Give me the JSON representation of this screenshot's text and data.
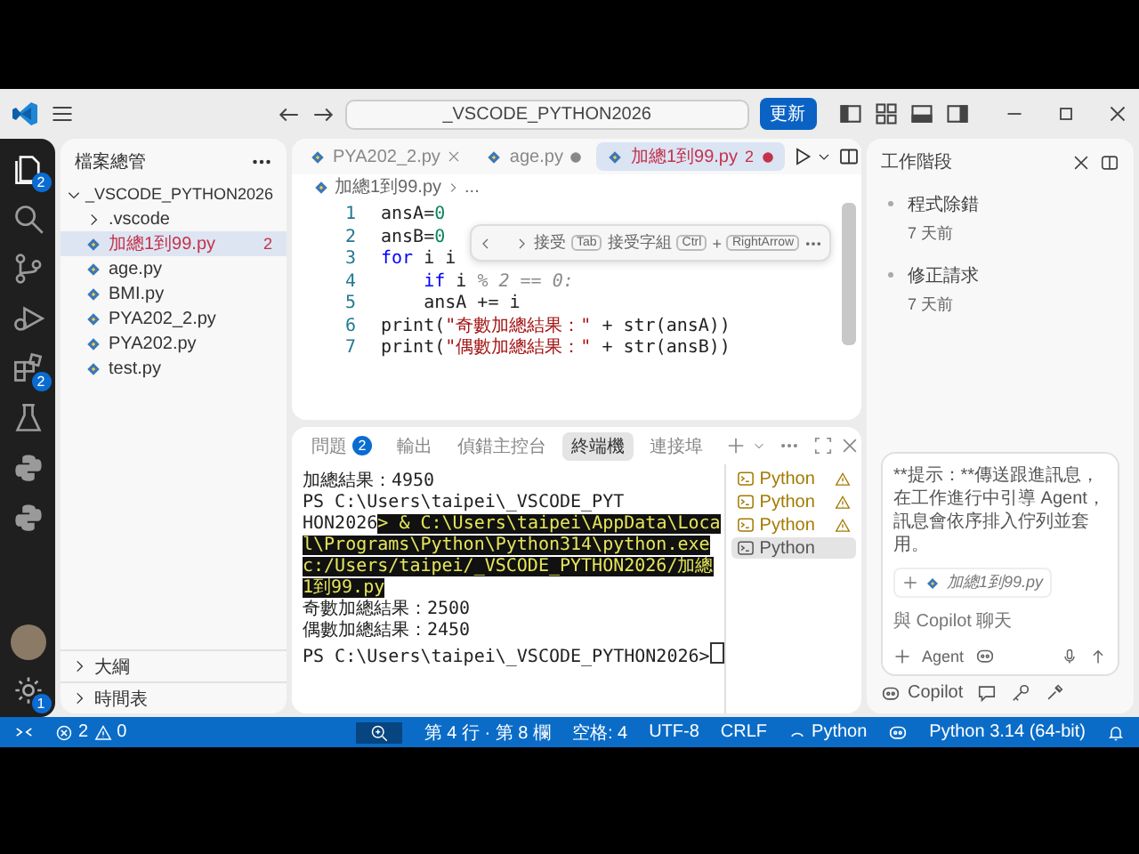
{
  "titlebar": {
    "search": "_VSCODE_PYTHON2026",
    "update_button": "更新"
  },
  "activity_bar": {
    "items": [
      {
        "kind": "explorer",
        "selected": true,
        "badge": "2"
      },
      {
        "kind": "search",
        "selected": false
      },
      {
        "kind": "source-control",
        "selected": false
      },
      {
        "kind": "run-debug",
        "selected": false
      },
      {
        "kind": "extensions",
        "selected": false,
        "badge": "2"
      },
      {
        "kind": "testing",
        "selected": false
      },
      {
        "kind": "python",
        "selected": false
      },
      {
        "kind": "python",
        "selected": false
      }
    ],
    "settings_badge": "1"
  },
  "explorer": {
    "title": "檔案總管",
    "folder": {
      "name": "_VSCODE_PYTHON2026",
      "expanded": true,
      "children": [
        {
          "kind": "folder",
          "name": ".vscode",
          "expanded": false,
          "selected": false
        },
        {
          "kind": "file",
          "name": "加總1到99.py",
          "selected": true,
          "problems": "2"
        },
        {
          "kind": "file",
          "name": "age.py",
          "selected": false
        },
        {
          "kind": "file",
          "name": "BMI.py",
          "selected": false
        },
        {
          "kind": "file",
          "name": "PYA202_2.py",
          "selected": false
        },
        {
          "kind": "file",
          "name": "PYA202.py",
          "selected": false
        },
        {
          "kind": "file",
          "name": "test.py",
          "selected": false
        }
      ]
    },
    "sections": [
      {
        "name": "大綱",
        "expanded": false
      },
      {
        "name": "時間表",
        "expanded": false
      }
    ]
  },
  "editor": {
    "tabs": [
      {
        "label": "PYA202_2.py",
        "selected": false,
        "modified": false
      },
      {
        "label": "age.py",
        "selected": false,
        "modified": true
      },
      {
        "label": "加總1到99.py",
        "selected": true,
        "modified": true,
        "problems": "2"
      }
    ],
    "breadcrumb": [
      "加總1到99.py",
      "..."
    ],
    "lines": [
      {
        "number": "1",
        "tokens": [
          {
            "kind": "plain",
            "text": "ansA="
          },
          {
            "kind": "number",
            "text": "0"
          }
        ]
      },
      {
        "number": "2",
        "tokens": [
          {
            "kind": "plain",
            "text": "ansB="
          },
          {
            "kind": "number",
            "text": "0"
          }
        ]
      },
      {
        "number": "3",
        "tokens": [
          {
            "kind": "keyword",
            "text": "for"
          },
          {
            "kind": "plain",
            "text": " i i"
          }
        ]
      },
      {
        "number": "4",
        "tokens": [
          {
            "kind": "keyword",
            "text": "    if"
          },
          {
            "kind": "plain",
            "text": " i"
          },
          {
            "kind": "ghost",
            "text": " % 2 == 0:"
          }
        ]
      },
      {
        "number": "5",
        "tokens": [
          {
            "kind": "plain",
            "text": "    ansA += i"
          }
        ]
      },
      {
        "number": "6",
        "tokens": [
          {
            "kind": "plain",
            "text": "print("
          },
          {
            "kind": "string",
            "text": "\"奇數加總結果：\""
          },
          {
            "kind": "plain",
            "text": " + str(ansA))"
          }
        ]
      },
      {
        "number": "7",
        "tokens": [
          {
            "kind": "plain",
            "text": "print("
          },
          {
            "kind": "string",
            "text": "\"偶數加總結果：\""
          },
          {
            "kind": "plain",
            "text": " + str(ansB))"
          }
        ]
      }
    ],
    "suggestion": {
      "accept": "接受",
      "accept_key": "Tab",
      "accept_word": "接受字組",
      "keys": [
        "Ctrl",
        "+",
        "RightArrow"
      ]
    }
  },
  "panel": {
    "tabs": [
      {
        "label": "問題",
        "selected": false,
        "badge": "2"
      },
      {
        "label": "輸出",
        "selected": false
      },
      {
        "label": "偵錯主控台",
        "selected": false
      },
      {
        "label": "終端機",
        "selected": true
      },
      {
        "label": "連接埠",
        "selected": false
      }
    ],
    "terminal": [
      [
        {
          "text": "加總結果：4950",
          "highlighted": false
        }
      ],
      [
        {
          "text": "PS C:\\Users\\taipei\\_VSCODE_PYT",
          "highlighted": false
        }
      ],
      [
        {
          "text": "HON2026",
          "highlighted": false
        },
        {
          "text": "> & C:\\Users\\taipei\\AppData\\Loca",
          "highlighted": true
        }
      ],
      [
        {
          "text": "l\\Programs\\Python\\Python314\\python.exe",
          "highlighted": true
        }
      ],
      [
        {
          "text": "c:/Users/taipei/_VSCODE_PYTHON2026/加總",
          "highlighted": true
        }
      ],
      [
        {
          "text": "1到99.py",
          "highlighted": true
        }
      ],
      [
        {
          "text": "奇數加總結果：2500",
          "highlighted": false
        }
      ],
      [
        {
          "text": "偶數加總結果：2450",
          "highlighted": false
        }
      ],
      [
        {
          "text": "PS C:\\Users\\taipei\\_VSCODE_PYTHON2026>",
          "highlighted": false
        }
      ]
    ],
    "terminals": [
      {
        "label": "Python",
        "warning": true,
        "selected": false
      },
      {
        "label": "Python",
        "warning": true,
        "selected": false
      },
      {
        "label": "Python",
        "warning": true,
        "selected": false
      },
      {
        "label": "Python",
        "warning": false,
        "selected": true
      }
    ]
  },
  "sessions": {
    "title": "工作階段",
    "items": [
      {
        "title": "程式除錯",
        "time": "7 天前"
      },
      {
        "title": "修正請求",
        "time": "7 天前"
      }
    ],
    "chat": {
      "hint": "**提示：**傳送跟進訊息，在工作進行中引導 Agent，訊息會依序排入佇列並套用。",
      "attachment": "加總1到99.py",
      "placeholder": "與 Copilot 聊天",
      "mode": "Agent"
    },
    "footer": "Copilot"
  },
  "status_bar": {
    "errors": "2",
    "warnings": "0",
    "position": "第 4 行 · 第 8 欄",
    "spaces": "空格: 4",
    "encoding": "UTF-8",
    "eol": "CRLF",
    "language": "Python",
    "interpreter": "Python 3.14 (64-bit)"
  }
}
